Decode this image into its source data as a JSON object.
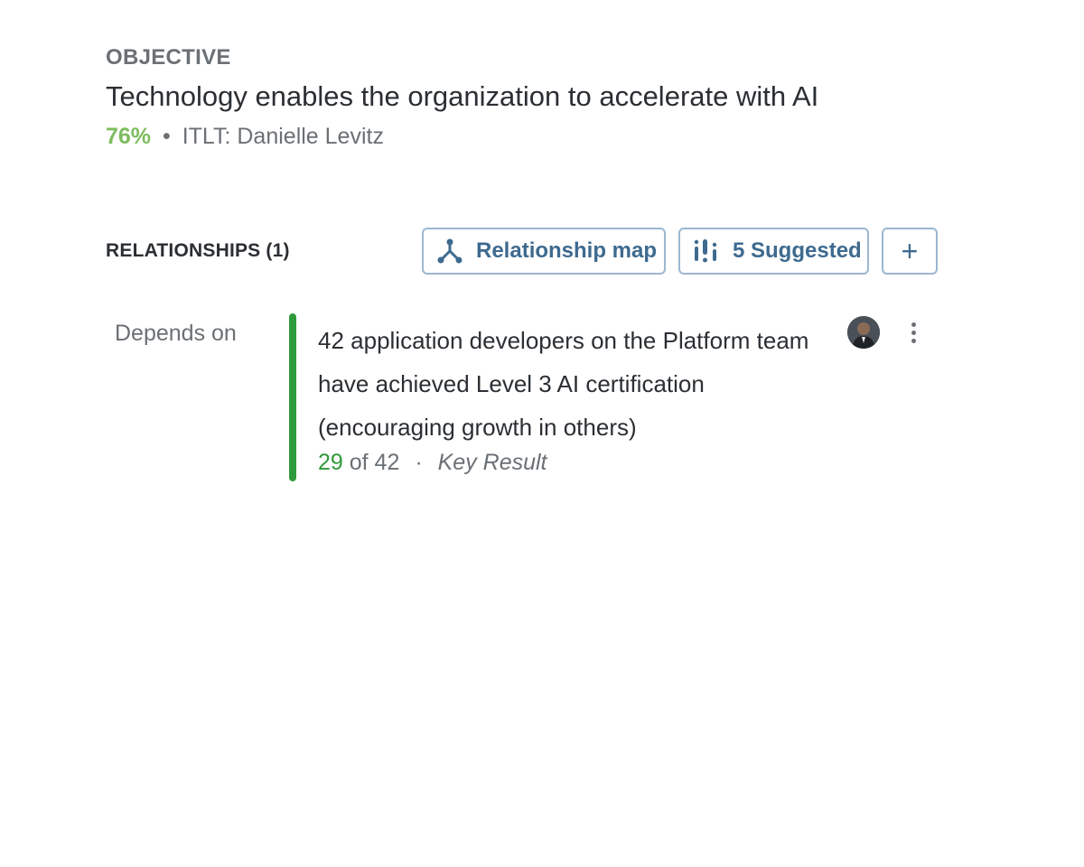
{
  "objective": {
    "label": "OBJECTIVE",
    "title": "Technology enables the organization to accelerate with AI",
    "progress": "76%",
    "separator": "•",
    "owner": "ITLT: Danielle Levitz"
  },
  "relationships": {
    "title": "RELATIONSHIPS (1)",
    "map_button": "Relationship map",
    "suggested_button": "5 Suggested",
    "add_button": "+",
    "items": [
      {
        "relation": "Depends on",
        "title": "42 application developers on the Platform team have achieved Level 3 AI certification (encouraging growth in others)",
        "current": "29",
        "of_target": "of 42",
        "separator": "·",
        "type": "Key Result",
        "avatar_icon": "user-avatar",
        "menu_icon": "more-vertical-icon"
      }
    ]
  },
  "colors": {
    "progress_green": "#7dbd5f",
    "bar_green": "#2f9a3b",
    "button_blue": "#3e6a8f",
    "button_border": "#9cb7cf",
    "muted_text": "#6b7075"
  }
}
